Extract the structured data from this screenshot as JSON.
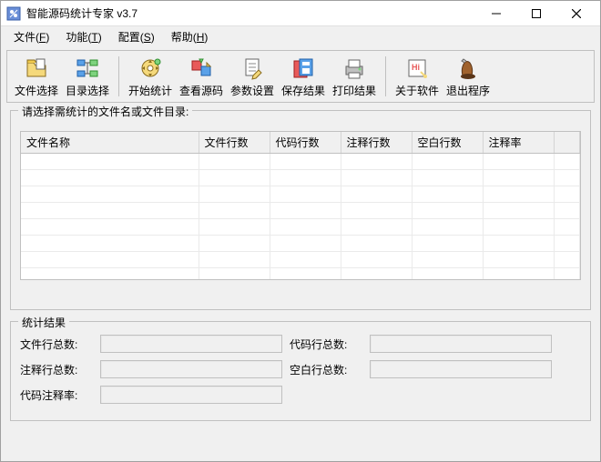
{
  "window": {
    "title": "智能源码统计专家 v3.7"
  },
  "menu": {
    "file": {
      "text": "文件(",
      "accel": "F",
      "suffix": ")"
    },
    "func": {
      "text": "功能(",
      "accel": "T",
      "suffix": ")"
    },
    "config": {
      "text": "配置(",
      "accel": "S",
      "suffix": ")"
    },
    "help": {
      "text": "帮助(",
      "accel": "H",
      "suffix": ")"
    }
  },
  "toolbar": {
    "file_select": "文件选择",
    "dir_select": "目录选择",
    "start_stat": "开始统计",
    "view_source": "查看源码",
    "param_set": "参数设置",
    "save_result": "保存结果",
    "print_result": "打印结果",
    "about": "关于软件",
    "exit": "退出程序"
  },
  "select_group": {
    "legend": "请选择需统计的文件名或文件目录:"
  },
  "columns": {
    "c0": "文件名称",
    "c1": "文件行数",
    "c2": "代码行数",
    "c3": "注释行数",
    "c4": "空白行数",
    "c5": "注释率"
  },
  "results": {
    "legend": "统计结果",
    "file_lines_label": "文件行总数:",
    "code_lines_label": "代码行总数:",
    "comment_lines_label": "注释行总数:",
    "blank_lines_label": "空白行总数:",
    "comment_rate_label": "代码注释率:",
    "file_lines": "",
    "code_lines": "",
    "comment_lines": "",
    "blank_lines": "",
    "comment_rate": ""
  }
}
